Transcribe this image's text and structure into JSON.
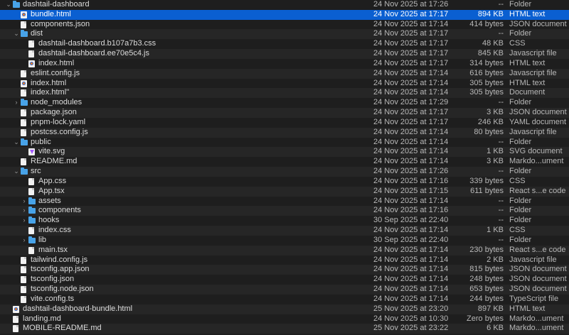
{
  "rows": [
    {
      "name": "dashtail-dashboard",
      "date": "24 Nov 2025 at 17:26",
      "size": "--",
      "kind": "Folder",
      "level": 0,
      "icon": "folder-icon",
      "chev": "open"
    },
    {
      "name": "bundle.html",
      "date": "24 Nov 2025 at 17:17",
      "size": "894 KB",
      "kind": "HTML text",
      "level": 1,
      "icon": "html-file-icon",
      "selected": true
    },
    {
      "name": "components.json",
      "date": "24 Nov 2025 at 17:14",
      "size": "414 bytes",
      "kind": "JSON document",
      "level": 1,
      "icon": "document-icon"
    },
    {
      "name": "dist",
      "date": "24 Nov 2025 at 17:17",
      "size": "--",
      "kind": "Folder",
      "level": 1,
      "icon": "folder-icon",
      "chev": "open"
    },
    {
      "name": "dashtail-dashboard.b107a7b3.css",
      "date": "24 Nov 2025 at 17:17",
      "size": "48 KB",
      "kind": "CSS",
      "level": 2,
      "icon": "document-icon"
    },
    {
      "name": "dashtail-dashboard.ee70e5c4.js",
      "date": "24 Nov 2025 at 17:17",
      "size": "845 KB",
      "kind": "Javascript file",
      "level": 2,
      "icon": "document-icon"
    },
    {
      "name": "index.html",
      "date": "24 Nov 2025 at 17:17",
      "size": "314 bytes",
      "kind": "HTML text",
      "level": 2,
      "icon": "html-file-icon"
    },
    {
      "name": "eslint.config.js",
      "date": "24 Nov 2025 at 17:14",
      "size": "616 bytes",
      "kind": "Javascript file",
      "level": 1,
      "icon": "document-icon"
    },
    {
      "name": "index.html",
      "date": "24 Nov 2025 at 17:14",
      "size": "305 bytes",
      "kind": "HTML text",
      "level": 1,
      "icon": "html-file-icon"
    },
    {
      "name": "index.html''",
      "date": "24 Nov 2025 at 17:14",
      "size": "305 bytes",
      "kind": "Document",
      "level": 1,
      "icon": "document-icon"
    },
    {
      "name": "node_modules",
      "date": "24 Nov 2025 at 17:29",
      "size": "--",
      "kind": "Folder",
      "level": 1,
      "icon": "folder-icon",
      "chev": "closed"
    },
    {
      "name": "package.json",
      "date": "24 Nov 2025 at 17:17",
      "size": "3 KB",
      "kind": "JSON document",
      "level": 1,
      "icon": "document-icon"
    },
    {
      "name": "pnpm-lock.yaml",
      "date": "24 Nov 2025 at 17:17",
      "size": "246 KB",
      "kind": "YAML document",
      "level": 1,
      "icon": "document-icon"
    },
    {
      "name": "postcss.config.js",
      "date": "24 Nov 2025 at 17:14",
      "size": "80 bytes",
      "kind": "Javascript file",
      "level": 1,
      "icon": "document-icon"
    },
    {
      "name": "public",
      "date": "24 Nov 2025 at 17:14",
      "size": "--",
      "kind": "Folder",
      "level": 1,
      "icon": "folder-icon",
      "chev": "open"
    },
    {
      "name": "vite.svg",
      "date": "24 Nov 2025 at 17:14",
      "size": "1 KB",
      "kind": "SVG document",
      "level": 2,
      "icon": "vite-svg-icon"
    },
    {
      "name": "README.md",
      "date": "24 Nov 2025 at 17:14",
      "size": "3 KB",
      "kind": "Markdo...ument",
      "level": 1,
      "icon": "document-icon"
    },
    {
      "name": "src",
      "date": "24 Nov 2025 at 17:26",
      "size": "--",
      "kind": "Folder",
      "level": 1,
      "icon": "folder-icon",
      "chev": "open"
    },
    {
      "name": "App.css",
      "date": "24 Nov 2025 at 17:16",
      "size": "339 bytes",
      "kind": "CSS",
      "level": 2,
      "icon": "document-icon"
    },
    {
      "name": "App.tsx",
      "date": "24 Nov 2025 at 17:15",
      "size": "611 bytes",
      "kind": "React s...e code",
      "level": 2,
      "icon": "document-icon"
    },
    {
      "name": "assets",
      "date": "24 Nov 2025 at 17:14",
      "size": "--",
      "kind": "Folder",
      "level": 2,
      "icon": "folder-icon",
      "chev": "closed"
    },
    {
      "name": "components",
      "date": "24 Nov 2025 at 17:16",
      "size": "--",
      "kind": "Folder",
      "level": 2,
      "icon": "folder-icon",
      "chev": "closed"
    },
    {
      "name": "hooks",
      "date": "30 Sep 2025 at 22:40",
      "size": "--",
      "kind": "Folder",
      "level": 2,
      "icon": "folder-icon",
      "chev": "closed"
    },
    {
      "name": "index.css",
      "date": "24 Nov 2025 at 17:14",
      "size": "1 KB",
      "kind": "CSS",
      "level": 2,
      "icon": "document-icon"
    },
    {
      "name": "lib",
      "date": "30 Sep 2025 at 22:40",
      "size": "--",
      "kind": "Folder",
      "level": 2,
      "icon": "folder-icon",
      "chev": "closed"
    },
    {
      "name": "main.tsx",
      "date": "24 Nov 2025 at 17:14",
      "size": "230 bytes",
      "kind": "React s...e code",
      "level": 2,
      "icon": "document-icon"
    },
    {
      "name": "tailwind.config.js",
      "date": "24 Nov 2025 at 17:14",
      "size": "2 KB",
      "kind": "Javascript file",
      "level": 1,
      "icon": "document-icon"
    },
    {
      "name": "tsconfig.app.json",
      "date": "24 Nov 2025 at 17:14",
      "size": "815 bytes",
      "kind": "JSON document",
      "level": 1,
      "icon": "document-icon"
    },
    {
      "name": "tsconfig.json",
      "date": "24 Nov 2025 at 17:14",
      "size": "248 bytes",
      "kind": "JSON document",
      "level": 1,
      "icon": "document-icon"
    },
    {
      "name": "tsconfig.node.json",
      "date": "24 Nov 2025 at 17:14",
      "size": "653 bytes",
      "kind": "JSON document",
      "level": 1,
      "icon": "document-icon"
    },
    {
      "name": "vite.config.ts",
      "date": "24 Nov 2025 at 17:14",
      "size": "244 bytes",
      "kind": "TypeScript file",
      "level": 1,
      "icon": "document-icon"
    },
    {
      "name": "dashtail-dashboard-bundle.html",
      "date": "25 Nov 2025 at 23:20",
      "size": "897 KB",
      "kind": "HTML text",
      "level": 0,
      "icon": "html-file-icon"
    },
    {
      "name": "landing.md",
      "date": "24 Nov 2025 at 10:30",
      "size": "Zero bytes",
      "kind": "Markdo...ument",
      "level": 0,
      "icon": "document-icon"
    },
    {
      "name": "MOBILE-README.md",
      "date": "25 Nov 2025 at 23:22",
      "size": "6 KB",
      "kind": "Markdo...ument",
      "level": 0,
      "icon": "document-icon"
    }
  ]
}
